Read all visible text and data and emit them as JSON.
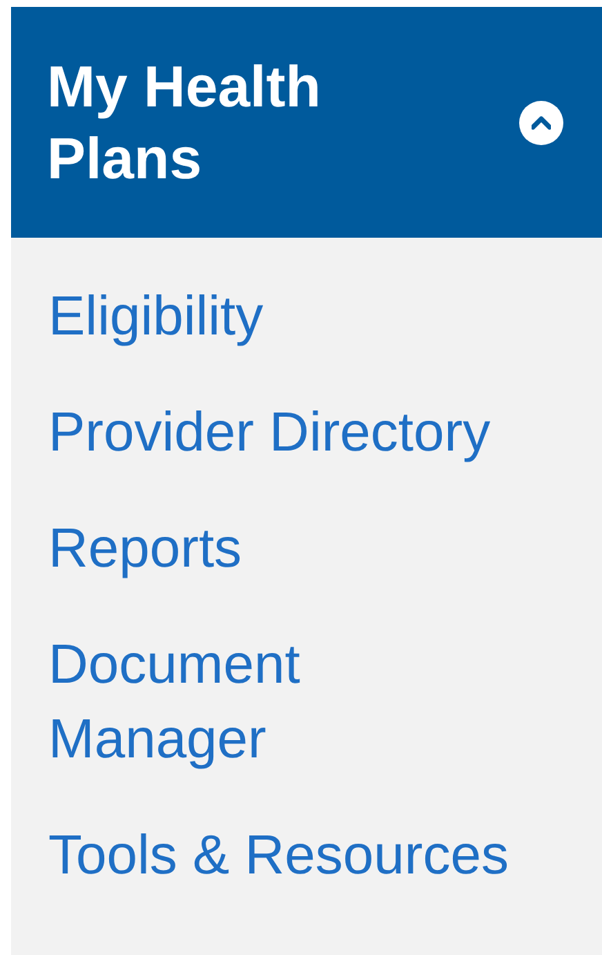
{
  "panel": {
    "title": "My Health Plans",
    "expanded": true
  },
  "links": [
    {
      "label": "Eligibility"
    },
    {
      "label": "Provider Directory"
    },
    {
      "label": "Reports"
    },
    {
      "label": "Document Manager"
    },
    {
      "label": "Tools & Resources"
    }
  ]
}
